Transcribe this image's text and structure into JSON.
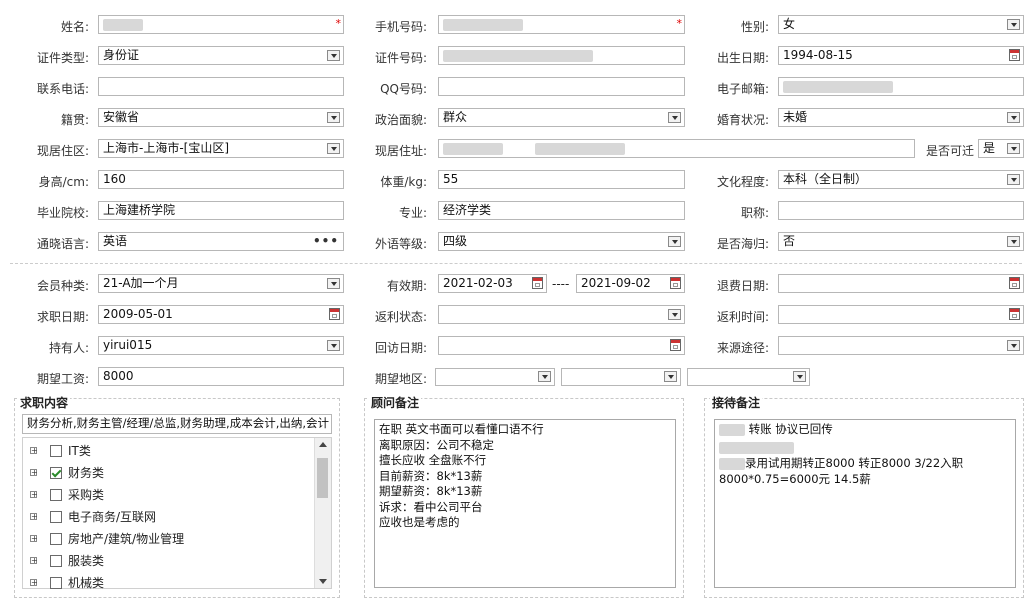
{
  "row1": {
    "name_label": "姓名:",
    "phone_label": "手机号码:",
    "gender_label": "性别:",
    "gender_value": "女",
    "required_mark": "*"
  },
  "row2": {
    "idtype_label": "证件类型:",
    "idtype_value": "身份证",
    "idno_label": "证件号码:",
    "birth_label": "出生日期:",
    "birth_value": "1994-08-15"
  },
  "row3": {
    "tel_label": "联系电话:",
    "qq_label": "QQ号码:",
    "email_label": "电子邮箱:"
  },
  "row4": {
    "native_label": "籍贯:",
    "native_value": "安徽省",
    "political_label": "政治面貌:",
    "political_value": "群众",
    "marital_label": "婚育状况:",
    "marital_value": "未婚"
  },
  "row5": {
    "residence_label": "现居住区:",
    "residence_value": "上海市-上海市-[宝山区]",
    "address_label": "现居住址:",
    "relocate_label": "是否可迁",
    "relocate_value": "是"
  },
  "row6": {
    "height_label": "身高/cm:",
    "height_value": "160",
    "weight_label": "体重/kg:",
    "weight_value": "55",
    "edu_label": "文化程度:",
    "edu_value": "本科（全日制）"
  },
  "row7": {
    "school_label": "毕业院校:",
    "school_value": "上海建桥学院",
    "major_label": "专业:",
    "major_value": "经济学类",
    "title_label": "职称:"
  },
  "row8": {
    "lang_label": "通晓语言:",
    "lang_value": "英语",
    "lang_btn": "•••",
    "foreign_label": "外语等级:",
    "foreign_value": "四级",
    "overseas_label": "是否海归:",
    "overseas_value": "否"
  },
  "row9": {
    "member_label": "会员种类:",
    "member_value": "21-A加一个月",
    "valid_label": "有效期:",
    "valid_from": "2021-02-03",
    "valid_sep": "----",
    "valid_to": "2021-09-02",
    "refund_label": "退费日期:"
  },
  "row10": {
    "jobdate_label": "求职日期:",
    "jobdate_value": "2009-05-01",
    "rebate_label": "返利状态:",
    "rebatetime_label": "返利时间:"
  },
  "row11": {
    "holder_label": "持有人:",
    "holder_value": "yirui015",
    "visit_label": "回访日期:",
    "source_label": "来源途径:"
  },
  "row12": {
    "salary_label": "期望工资:",
    "salary_value": "8000",
    "region_label": "期望地区:"
  },
  "job": {
    "title": "求职内容",
    "selected_text": "财务分析,财务主管/经理/总监,财务助理,成本会计,出纳,会计",
    "tree": [
      {
        "label": "IT类",
        "checked": false
      },
      {
        "label": "财务类",
        "checked": true
      },
      {
        "label": "采购类",
        "checked": false
      },
      {
        "label": "电子商务/互联网",
        "checked": false
      },
      {
        "label": "房地产/建筑/物业管理",
        "checked": false
      },
      {
        "label": "服装类",
        "checked": false
      },
      {
        "label": "机械类",
        "checked": false
      }
    ]
  },
  "advisor": {
    "title": "顾问备注",
    "lines": [
      "在职 英文书面可以看懂口语不行",
      "离职原因：公司不稳定",
      "擅长应收 全盘账不行",
      "目前薪资：8k*13薪",
      "期望薪资：8k*13薪",
      "诉求：看中公司平台",
      "应收也是考虑的"
    ]
  },
  "reception": {
    "title": "接待备注",
    "line1": "转账 协议已回传",
    "line3": "录用试用期转正8000 转正8000 3/22入职",
    "line4": "8000*0.75=6000元  14.5薪"
  },
  "icons": {
    "dropdown": "chevron-down-icon",
    "calendar": "calendar-icon",
    "more": "ellipsis-icon",
    "expand": "plus-icon"
  }
}
